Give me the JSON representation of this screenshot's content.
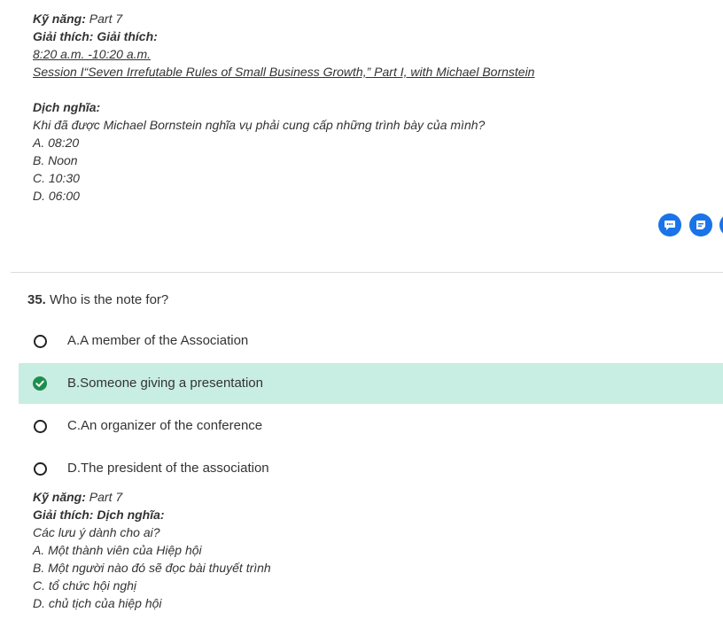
{
  "explanation_top": {
    "skill_label": "Kỹ năng:",
    "skill_value": "Part 7",
    "explain_label": "Giải thích: Giải thích:",
    "time_line": "8:20 a.m. -10:20 a.m.",
    "session_line": "Session I“Seven Irrefutable Rules of Small Business Growth,” Part I, with Michael Bornstein",
    "translation_label": "Dịch nghĩa:",
    "translation_question": "Khi đã được Michael Bornstein nghĩa vụ phải cung cấp những trình bày của mình?",
    "options": [
      "A. 08:20",
      "B. Noon",
      "C. 10:30",
      "D. 06:00"
    ]
  },
  "action_icons": [
    "chat-icon",
    "note-icon",
    "extra-icon"
  ],
  "question": {
    "number": "35.",
    "text": "Who is the note for?",
    "options": [
      {
        "label": "A.A member of the Association",
        "state": "unselected"
      },
      {
        "label": "B.Someone giving a presentation",
        "state": "correct"
      },
      {
        "label": "C.An organizer of the conference",
        "state": "unselected"
      },
      {
        "label": "D.The president of the association",
        "state": "unselected"
      }
    ]
  },
  "explanation_bottom": {
    "skill_label": "Kỹ năng:",
    "skill_value": "Part 7",
    "explain_label": "Giải thích: Dịch nghĩa:",
    "lines": [
      "Các lưu ý dành cho ai?",
      "A. Một thành viên của Hiệp hội",
      "B. Một người nào đó sẽ đọc bài thuyết trình",
      "C. tổ chức hội nghị",
      "D. chủ tịch của hiệp hội"
    ]
  },
  "colors": {
    "accent_blue": "#1a73e8",
    "correct_bg": "#c8ede3",
    "correct_check": "#1e8e4e"
  }
}
